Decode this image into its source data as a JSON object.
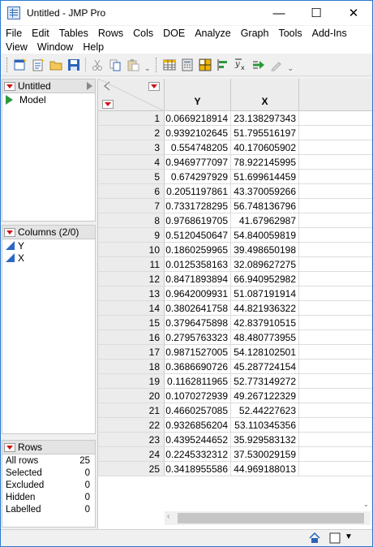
{
  "window": {
    "title": "Untitled - JMP Pro",
    "minimize_glyph": "—",
    "maximize_glyph": "☐",
    "close_glyph": "✕"
  },
  "menu": {
    "row1": [
      "File",
      "Edit",
      "Tables",
      "Rows",
      "Cols",
      "DOE",
      "Analyze",
      "Graph",
      "Tools",
      "Add-Ins"
    ],
    "row2": [
      "View",
      "Window",
      "Help"
    ]
  },
  "toolbar": {
    "icons": [
      "new-data-table-icon",
      "new-script-icon",
      "open-folder-icon",
      "save-icon",
      "cut-icon",
      "copy-icon",
      "paste-icon",
      "data-grid-icon",
      "calculator-icon",
      "table-grid-icon",
      "align-icon",
      "formula-icon",
      "arrow-icon",
      "edit-icon"
    ]
  },
  "table_panel": {
    "title": "Untitled",
    "items": [
      "Model"
    ]
  },
  "columns_panel": {
    "title": "Columns (2/0)",
    "columns": [
      "Y",
      "X"
    ]
  },
  "rows_panel": {
    "title": "Rows",
    "stats": [
      {
        "label": "All rows",
        "value": "25"
      },
      {
        "label": "Selected",
        "value": "0"
      },
      {
        "label": "Excluded",
        "value": "0"
      },
      {
        "label": "Hidden",
        "value": "0"
      },
      {
        "label": "Labelled",
        "value": "0"
      }
    ]
  },
  "grid": {
    "headers": [
      "Y",
      "X"
    ],
    "rows": [
      [
        "1",
        "0.0669218914",
        "23.138297343"
      ],
      [
        "2",
        "0.9392102645",
        "51.795516197"
      ],
      [
        "3",
        "0.554748205",
        "40.170605902"
      ],
      [
        "4",
        "0.9469777097",
        "78.922145995"
      ],
      [
        "5",
        "0.674297929",
        "51.699614459"
      ],
      [
        "6",
        "0.2051197861",
        "43.370059266"
      ],
      [
        "7",
        "0.7331728295",
        "56.748136796"
      ],
      [
        "8",
        "0.9768619705",
        "41.67962987"
      ],
      [
        "9",
        "0.5120450647",
        "54.840059819"
      ],
      [
        "10",
        "0.1860259965",
        "39.498650198"
      ],
      [
        "11",
        "0.0125358163",
        "32.089627275"
      ],
      [
        "12",
        "0.8471893894",
        "66.940952982"
      ],
      [
        "13",
        "0.9642009931",
        "51.087191914"
      ],
      [
        "14",
        "0.3802641758",
        "44.821936322"
      ],
      [
        "15",
        "0.3796475898",
        "42.837910515"
      ],
      [
        "16",
        "0.2795763323",
        "48.480773955"
      ],
      [
        "17",
        "0.9871527005",
        "54.128102501"
      ],
      [
        "18",
        "0.3686690726",
        "45.287724154"
      ],
      [
        "19",
        "0.1162811965",
        "52.773149272"
      ],
      [
        "20",
        "0.1070272939",
        "49.267122329"
      ],
      [
        "21",
        "0.4660257085",
        "52.44227623"
      ],
      [
        "22",
        "0.9326856204",
        "53.110345356"
      ],
      [
        "23",
        "0.4395244652",
        "35.929583132"
      ],
      [
        "24",
        "0.2245332312",
        "37.530029159"
      ],
      [
        "25",
        "0.3418955586",
        "44.969188013"
      ]
    ]
  },
  "colors": {
    "accent": "#2b79d0",
    "red_triangle": "#d01414",
    "column_icon": "#2d67c4",
    "model_play": "#2c9a3c"
  }
}
